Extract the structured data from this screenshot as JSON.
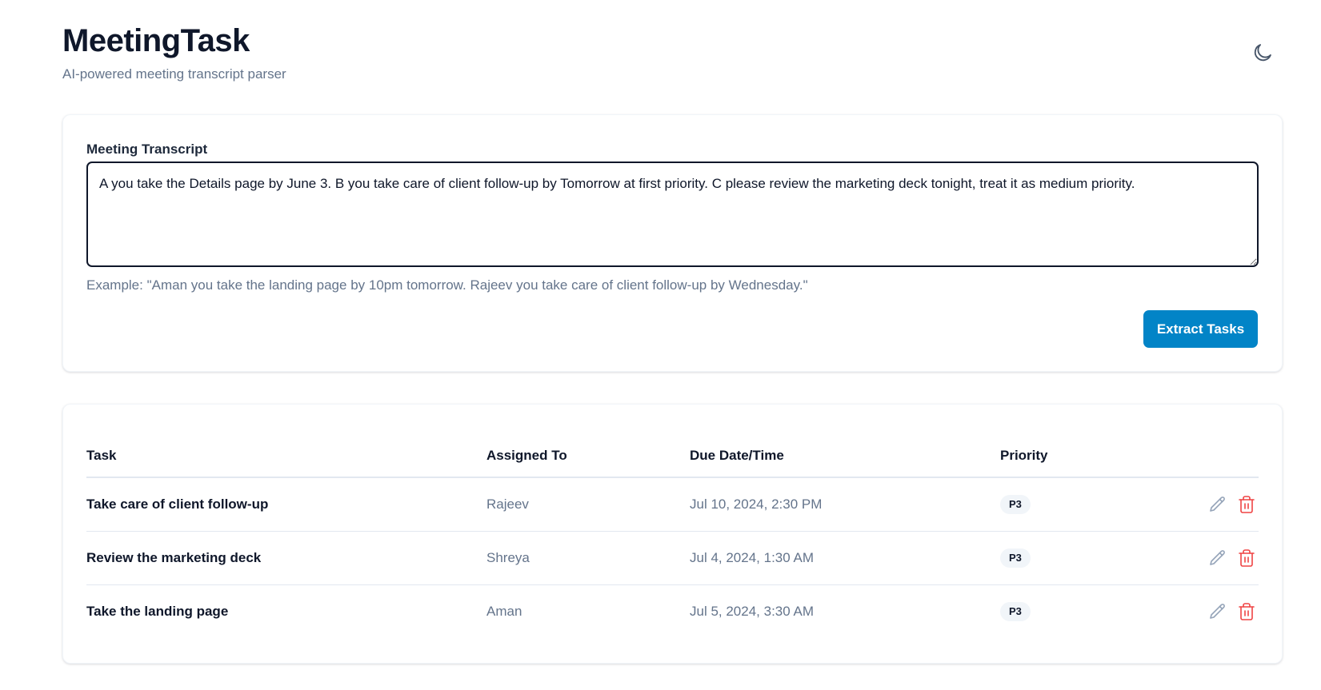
{
  "header": {
    "title": "MeetingTask",
    "subtitle": "AI-powered meeting transcript parser",
    "theme_toggle_icon": "moon-icon"
  },
  "input_card": {
    "label": "Meeting Transcript",
    "transcript_value": "A you take the Details page by June 3. B you take care of client follow-up by Tomorrow at first priority. C please review the marketing deck tonight, treat it as medium priority.",
    "helper_text": "Example: \"Aman you take the landing page by 10pm tomorrow. Rajeev you take care of client follow-up by Wednesday.\"",
    "extract_button": "Extract Tasks"
  },
  "tasks_table": {
    "headers": {
      "task": "Task",
      "assignee": "Assigned To",
      "due": "Due Date/Time",
      "priority": "Priority"
    },
    "rows": [
      {
        "task": "Take care of client follow-up",
        "assignee": "Rajeev",
        "due": "Jul 10, 2024, 2:30 PM",
        "priority": "P3"
      },
      {
        "task": "Review the marketing deck",
        "assignee": "Shreya",
        "due": "Jul 4, 2024, 1:30 AM",
        "priority": "P3"
      },
      {
        "task": "Take the landing page",
        "assignee": "Aman",
        "due": "Jul 5, 2024, 3:30 AM",
        "priority": "P3"
      }
    ],
    "row_action_icons": [
      "pencil-icon",
      "trash-icon"
    ]
  },
  "colors": {
    "accent": "#0284c7",
    "title_text": "#0f172a",
    "muted_text": "#64748b",
    "delete_icon": "#ef4444",
    "edit_icon": "#94a3b8"
  }
}
